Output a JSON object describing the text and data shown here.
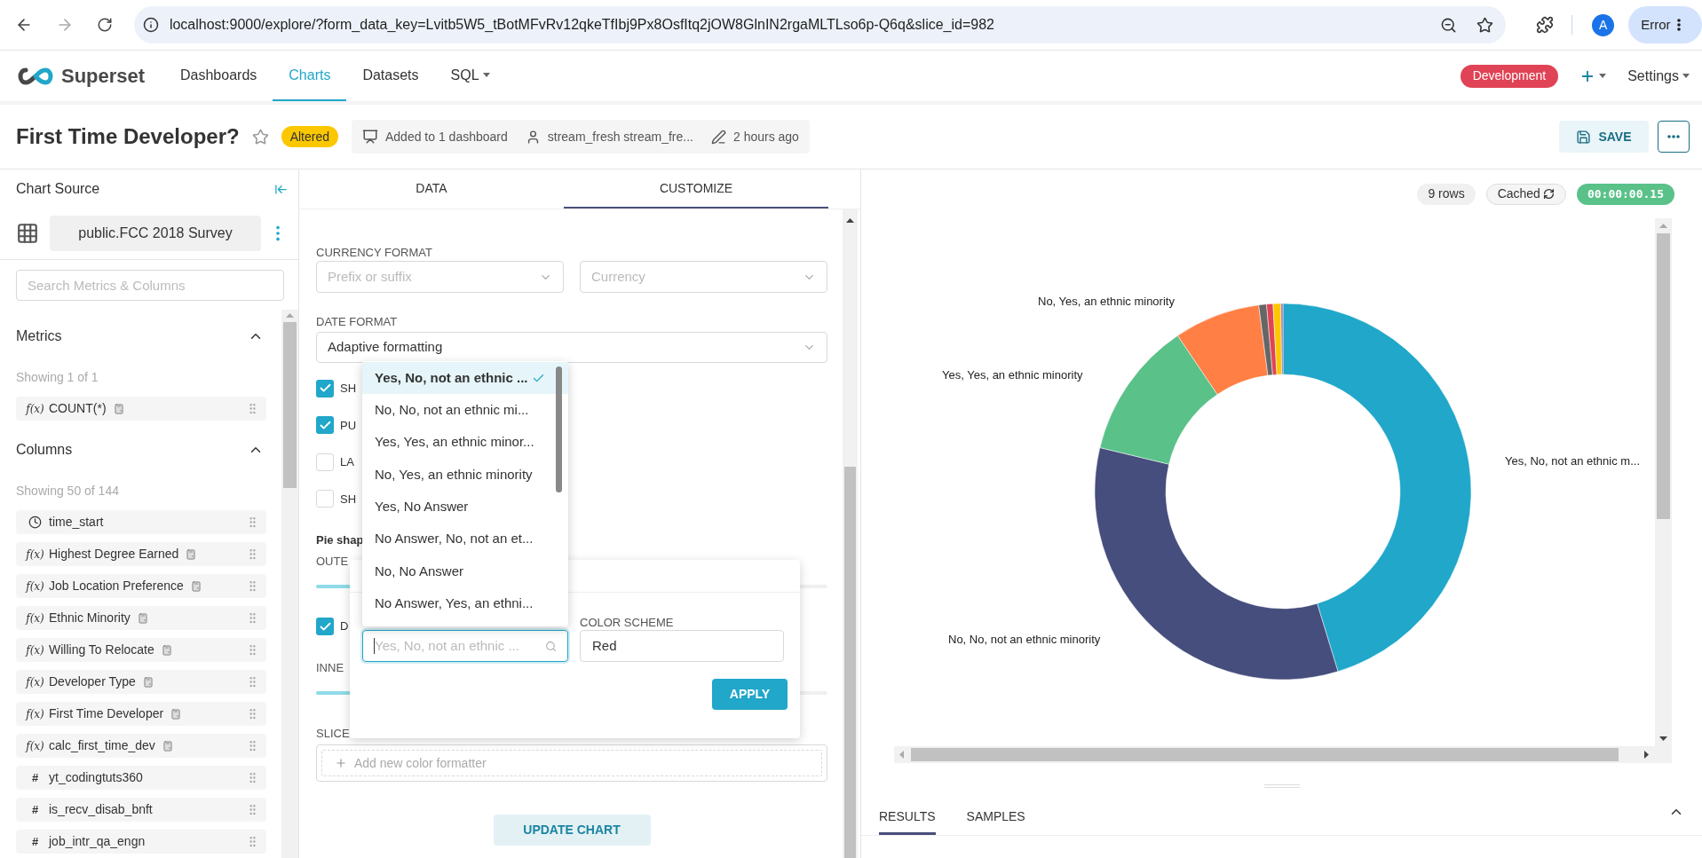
{
  "browser": {
    "url": "localhost:9000/explore/?form_data_key=Lvitb5W5_tBotMFvRv12qkeTfIbj9Px8OsfItq2jOW8GlnIN2rgaMLTLso6p-Q6q&slice_id=982",
    "profile_initial": "A",
    "profile_status": "Error"
  },
  "nav": {
    "brand": "Superset",
    "items": [
      {
        "label": "Dashboards",
        "selected": false,
        "caret": false
      },
      {
        "label": "Charts",
        "selected": true,
        "caret": false
      },
      {
        "label": "Datasets",
        "selected": false,
        "caret": false
      },
      {
        "label": "SQL",
        "selected": false,
        "caret": true
      }
    ],
    "environment": "Development",
    "settings": "Settings"
  },
  "header": {
    "title": "First Time Developer?",
    "status": "Altered",
    "dashboards": "Added to 1 dashboard",
    "owner": "stream_fresh stream_fre...",
    "modified": "2 hours ago",
    "save": "SAVE"
  },
  "sidebar": {
    "title": "Chart Source",
    "dataset": "public.FCC 2018 Survey",
    "search_placeholder": "Search Metrics & Columns",
    "sections": [
      {
        "title": "Metrics",
        "expanded": true,
        "count": "Showing 1 of 1",
        "items": [
          {
            "kind": "expression",
            "icon": "f(x)",
            "label": "COUNT(*)"
          }
        ]
      },
      {
        "title": "Columns",
        "expanded": true,
        "count": "Showing 50 of 144",
        "items": [
          {
            "kind": "datetime",
            "label": "time_start"
          },
          {
            "kind": "expression",
            "icon": "f(x)",
            "label": "Highest Degree Earned"
          },
          {
            "kind": "expression",
            "icon": "f(x)",
            "label": "Job Location Preference"
          },
          {
            "kind": "expression",
            "icon": "f(x)",
            "label": "Ethnic Minority"
          },
          {
            "kind": "expression",
            "icon": "f(x)",
            "label": "Willing To Relocate"
          },
          {
            "kind": "expression",
            "icon": "f(x)",
            "label": "Developer Type"
          },
          {
            "kind": "expression",
            "icon": "f(x)",
            "label": "First Time Developer"
          },
          {
            "kind": "expression",
            "icon": "f(x)",
            "label": "calc_first_time_dev"
          },
          {
            "kind": "numeric",
            "icon": "#",
            "label": "yt_codingtuts360"
          },
          {
            "kind": "numeric",
            "icon": "#",
            "label": "is_recv_disab_bnft"
          },
          {
            "kind": "numeric",
            "icon": "#",
            "label": "job_intr_qa_engn"
          }
        ]
      }
    ]
  },
  "controls": {
    "tabs": [
      {
        "label": "DATA",
        "selected": false
      },
      {
        "label": "CUSTOMIZE",
        "selected": true
      }
    ],
    "currency_label": "CURRENCY FORMAT",
    "currency_fields": [
      {
        "placeholder": "Prefix or suffix"
      },
      {
        "placeholder": "Currency"
      }
    ],
    "date_label": "DATE FORMAT",
    "date_value": "Adaptive formatting",
    "checkboxes": [
      {
        "label": "SH",
        "checked": true
      },
      {
        "label": "PU",
        "checked": true
      },
      {
        "label": "LA",
        "checked": false
      },
      {
        "label": "SH",
        "checked": false
      }
    ],
    "pie_shape": "Pie shap",
    "outer_label": "OUTE",
    "donut": {
      "label": "D",
      "checked": true
    },
    "inner_label": "INNE",
    "slice_label": "SLICE",
    "add_formatter": "Add new color formatter",
    "update": "UPDATE CHART"
  },
  "formatter_popover": {
    "value_placeholder": "Yes, No, not an ethnic ...",
    "color_label": "COLOR SCHEME",
    "color_value": "Red",
    "apply": "APPLY",
    "options": [
      {
        "label": "Yes, No, not an ethnic ...",
        "selected": true
      },
      {
        "label": "No, No, not an ethnic mi...",
        "selected": false
      },
      {
        "label": "Yes, Yes, an ethnic minor...",
        "selected": false
      },
      {
        "label": "No, Yes, an ethnic minority",
        "selected": false
      },
      {
        "label": "Yes, No Answer",
        "selected": false
      },
      {
        "label": "No Answer, No, not an et...",
        "selected": false
      },
      {
        "label": "No, No Answer",
        "selected": false
      },
      {
        "label": "No Answer, Yes, an ethni...",
        "selected": false
      }
    ]
  },
  "chart": {
    "rows": "9 rows",
    "cached": "Cached",
    "timer": "00:00:00.15",
    "labels": [
      {
        "label": "No, Yes, an ethnic minority"
      },
      {
        "label": "Yes, Yes, an ethnic minority"
      },
      {
        "label": "Yes, No, not an ethnic m..."
      },
      {
        "label": "No, No, not an ethnic minority"
      }
    ]
  },
  "results_tabs": [
    {
      "label": "RESULTS",
      "selected": true
    },
    {
      "label": "SAMPLES",
      "selected": false
    }
  ]
}
